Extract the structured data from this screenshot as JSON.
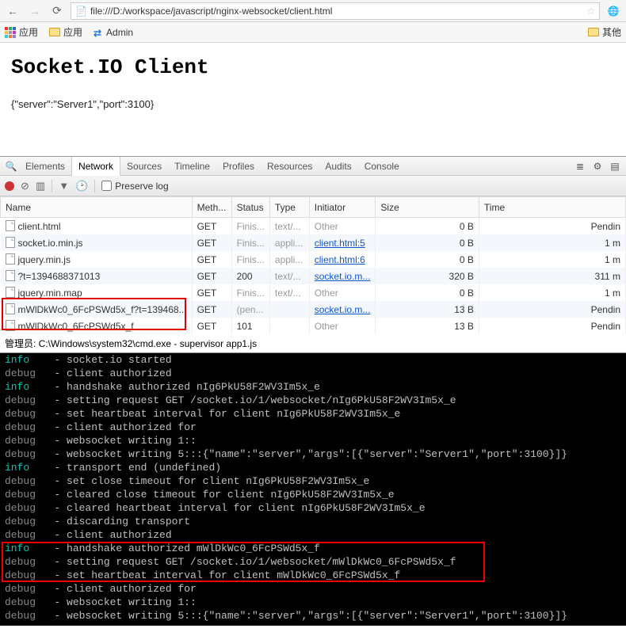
{
  "browser": {
    "url": "file:///D:/workspace/javascript/nginx-websocket/client.html",
    "bookmarks": {
      "apps1": "应用",
      "apps2": "应用",
      "admin": "Admin",
      "other": "其他"
    }
  },
  "page": {
    "title": "Socket.IO Client",
    "payload": "{\"server\":\"Server1\",\"port\":3100}"
  },
  "devtools": {
    "tabs": [
      "Elements",
      "Network",
      "Sources",
      "Timeline",
      "Profiles",
      "Resources",
      "Audits",
      "Console"
    ],
    "active_tab": "Network",
    "preserve_log_label": "Preserve log",
    "columns": {
      "name": "Name",
      "method": "Meth...",
      "status": "Status",
      "type": "Type",
      "initiator": "Initiator",
      "size": "Size",
      "time": "Time"
    },
    "rows": [
      {
        "name": "client.html",
        "method": "GET",
        "status": "Finis...",
        "type": "text/...",
        "initiator": "Other",
        "initiator_link": false,
        "size": "0 B",
        "time": "Pendin"
      },
      {
        "name": "socket.io.min.js",
        "method": "GET",
        "status": "Finis...",
        "type": "appli...",
        "initiator": "client.html:5",
        "initiator_link": true,
        "size": "0 B",
        "time": "1 m"
      },
      {
        "name": "jquery.min.js",
        "method": "GET",
        "status": "Finis...",
        "type": "appli...",
        "initiator": "client.html:6",
        "initiator_link": true,
        "size": "0 B",
        "time": "1 m"
      },
      {
        "name": "?t=1394688371013",
        "method": "GET",
        "status": "200",
        "type": "text/...",
        "initiator": "socket.io.m...",
        "initiator_link": true,
        "size": "320 B",
        "time": "311 m"
      },
      {
        "name": "jquery.min.map",
        "method": "GET",
        "status": "Finis...",
        "type": "text/...",
        "initiator": "Other",
        "initiator_link": false,
        "size": "0 B",
        "time": "1 m"
      },
      {
        "name": "mWlDkWc0_6FcPSWd5x_f?t=139468...",
        "method": "GET",
        "status": "(pen...",
        "type": "",
        "initiator": "socket.io.m...",
        "initiator_link": true,
        "size": "13 B",
        "time": "Pendin"
      },
      {
        "name": "mWlDkWc0_6FcPSWd5x_f",
        "method": "GET",
        "status": "101",
        "type": "",
        "initiator": "Other",
        "initiator_link": false,
        "size": "13 B",
        "time": "Pendin"
      }
    ]
  },
  "terminal": {
    "title": "管理员: C:\\Windows\\system32\\cmd.exe - supervisor  app1.js",
    "lines": [
      {
        "level": "info",
        "text": "socket.io started"
      },
      {
        "level": "debug",
        "text": "client authorized"
      },
      {
        "level": "info",
        "text": "handshake authorized nIg6PkU58F2WV3Im5x_e"
      },
      {
        "level": "debug",
        "text": "setting request GET /socket.io/1/websocket/nIg6PkU58F2WV3Im5x_e"
      },
      {
        "level": "debug",
        "text": "set heartbeat interval for client nIg6PkU58F2WV3Im5x_e"
      },
      {
        "level": "debug",
        "text": "client authorized for"
      },
      {
        "level": "debug",
        "text": "websocket writing 1::"
      },
      {
        "level": "debug",
        "text": "websocket writing 5:::{\"name\":\"server\",\"args\":[{\"server\":\"Server1\",\"port\":3100}]}"
      },
      {
        "level": "info",
        "text": "transport end (undefined)"
      },
      {
        "level": "debug",
        "text": "set close timeout for client nIg6PkU58F2WV3Im5x_e"
      },
      {
        "level": "debug",
        "text": "cleared close timeout for client nIg6PkU58F2WV3Im5x_e"
      },
      {
        "level": "debug",
        "text": "cleared heartbeat interval for client nIg6PkU58F2WV3Im5x_e"
      },
      {
        "level": "debug",
        "text": "discarding transport"
      },
      {
        "level": "debug",
        "text": "client authorized"
      },
      {
        "level": "info",
        "text": "handshake authorized mWlDkWc0_6FcPSWd5x_f"
      },
      {
        "level": "debug",
        "text": "setting request GET /socket.io/1/websocket/mWlDkWc0_6FcPSWd5x_f"
      },
      {
        "level": "debug",
        "text": "set heartbeat interval for client mWlDkWc0_6FcPSWd5x_f"
      },
      {
        "level": "debug",
        "text": "client authorized for"
      },
      {
        "level": "debug",
        "text": "websocket writing 1::"
      },
      {
        "level": "debug",
        "text": "websocket writing 5:::{\"name\":\"server\",\"args\":[{\"server\":\"Server1\",\"port\":3100}]}"
      }
    ],
    "highlight_start": 14,
    "highlight_end": 16
  }
}
